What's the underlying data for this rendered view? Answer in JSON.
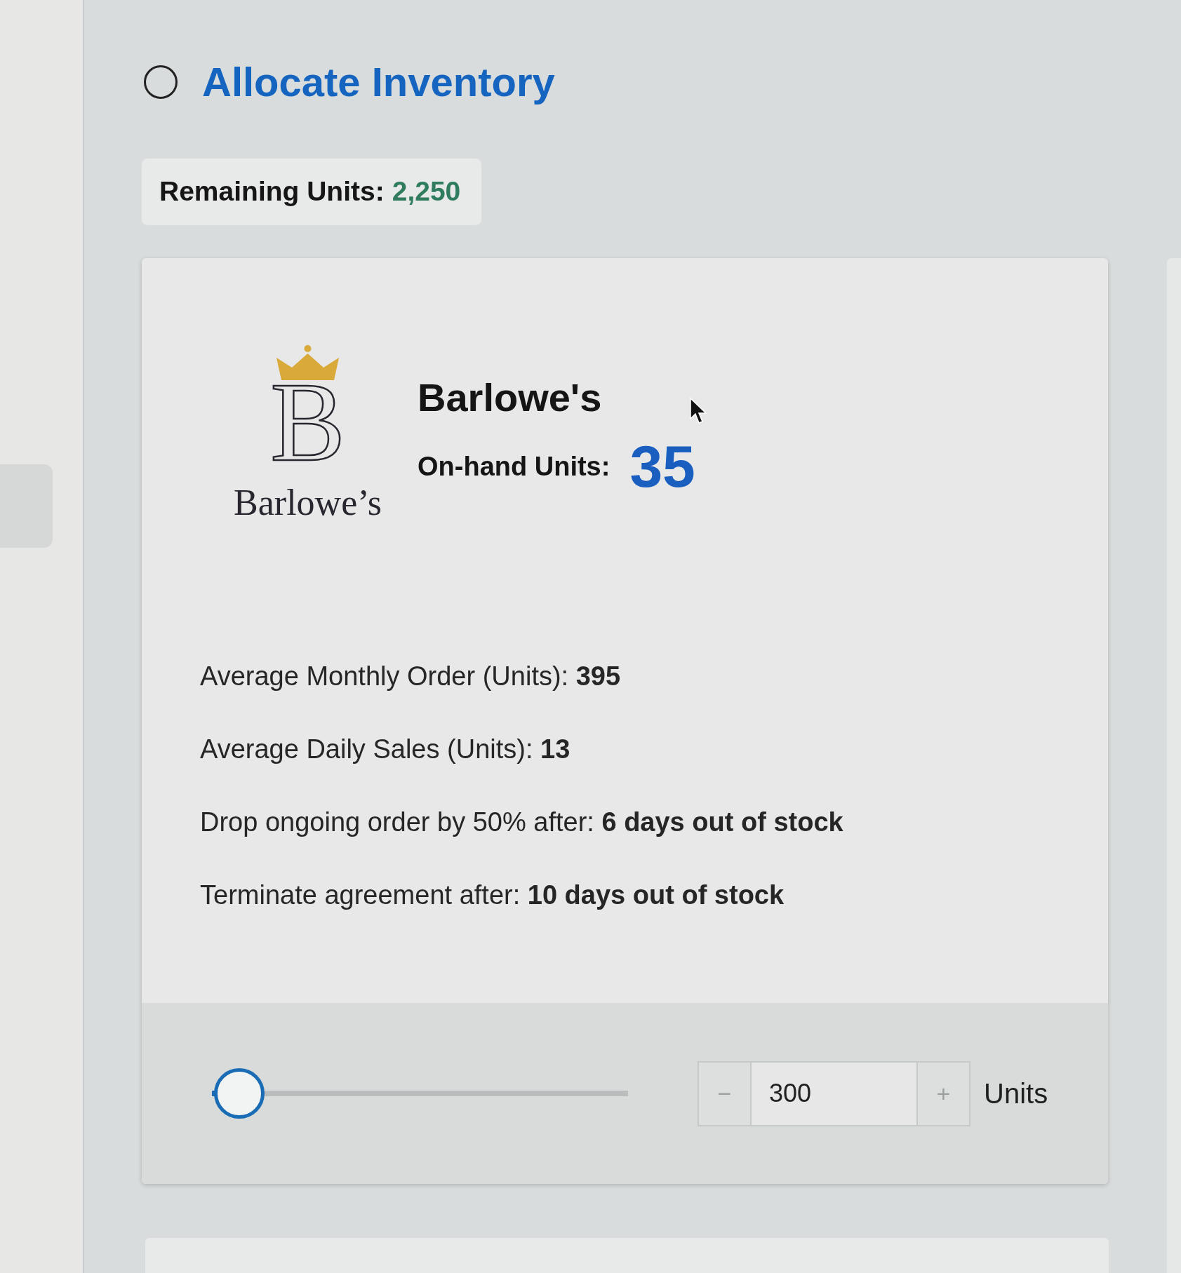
{
  "header": {
    "checked": false,
    "title": "Allocate Inventory"
  },
  "remaining": {
    "label": "Remaining Units:",
    "value": "2,250"
  },
  "card": {
    "logo": {
      "monogram": "B",
      "wordmark": "Barlowe’s"
    },
    "name": "Barlowe's",
    "on_hand": {
      "label": "On-hand Units:",
      "value": "35"
    },
    "stats": [
      "Average Monthly Order (Units): **395**",
      "Average Daily Sales (Units): **13**",
      "Drop ongoing order by 50% after: **6 days out of stock**",
      "Terminate agreement after: **10 days out of stock**"
    ],
    "allocation": {
      "level": 0.06,
      "decrement": "−",
      "value": "300",
      "increment": "+",
      "unit": "Units"
    }
  }
}
